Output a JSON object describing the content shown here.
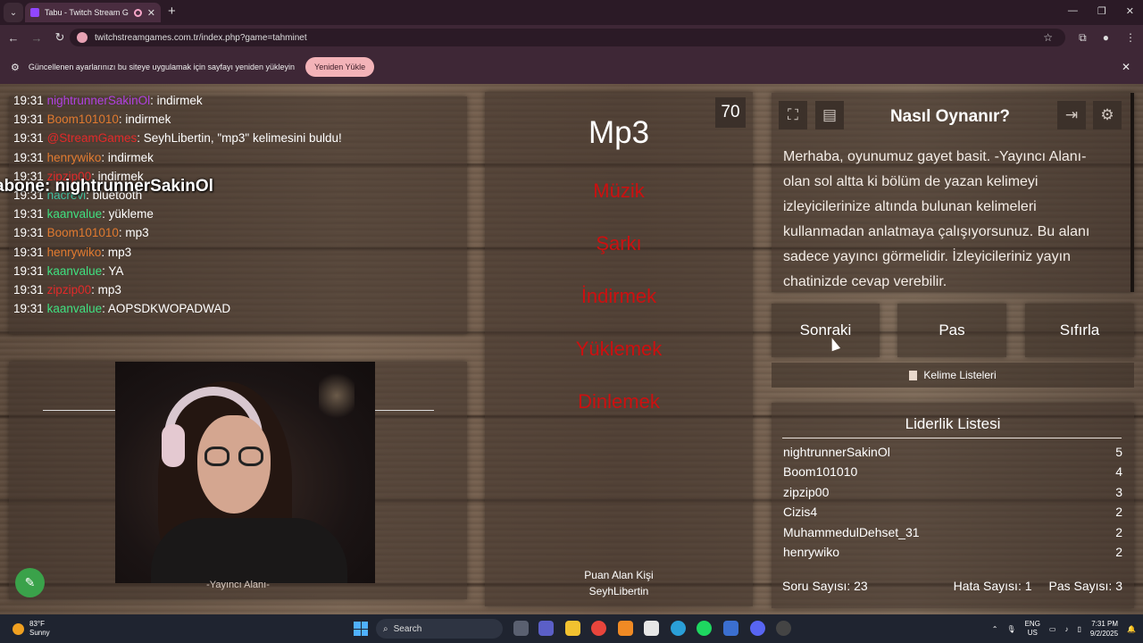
{
  "browser": {
    "tab_title": "Tabu - Twitch Stream Games",
    "url": "twitchstreamgames.com.tr/index.php?game=tahminet",
    "infobar_text": "Güncellenen ayarlarınızı bu siteye uygulamak için sayfayı yeniden yükleyin",
    "reload_label": "Yeniden Yükle"
  },
  "chat": {
    "lines": [
      {
        "time": "19:31",
        "user": "nightrunnerSakinOl",
        "color": "#b040e0",
        "msg": ": indirmek"
      },
      {
        "time": "19:31",
        "user": "Boom101010",
        "color": "#e07a30",
        "msg": ": indirmek"
      },
      {
        "time": "19:31",
        "user": "@StreamGames",
        "color": "#e02a2a",
        "msg": ": SeyhLibertin, \"mp3\" kelimesini buldu!"
      },
      {
        "time": "19:31",
        "user": "henrywiko",
        "color": "#e07a30",
        "msg": ": indirmek"
      },
      {
        "time": "19:31",
        "user": "zipzip00",
        "color": "#e02a2a",
        "msg": ": indirmek"
      },
      {
        "time": "19:31",
        "user": "nacrevi",
        "color": "#40c0a0",
        "msg": ": bluetooth"
      },
      {
        "time": "19:31",
        "user": "kaanvalue",
        "color": "#40e080",
        "msg": ": yükleme"
      },
      {
        "time": "19:31",
        "user": "Boom101010",
        "color": "#e07a30",
        "msg": ": mp3"
      },
      {
        "time": "19:31",
        "user": "henrywiko",
        "color": "#e07a30",
        "msg": ": mp3"
      },
      {
        "time": "19:31",
        "user": "kaanvalue",
        "color": "#40e080",
        "msg": ": YA"
      },
      {
        "time": "19:31",
        "user": "zipzip00",
        "color": "#e02a2a",
        "msg": ": mp3"
      },
      {
        "time": "19:31",
        "user": "kaanvalue",
        "color": "#40e080",
        "msg": ": AOPSDKWOPADWAD"
      }
    ],
    "overlay": "abone: nightrunnerSakinOl"
  },
  "streamer": {
    "caption": "-Yayıncı Alanı-"
  },
  "game": {
    "timer": "70",
    "word": "Mp3",
    "forbidden": [
      "Müzik",
      "Şarkı",
      "İndirmek",
      "Yüklemek",
      "Dinlemek"
    ],
    "point_label": "Puan Alan Kişi",
    "point_user": "SeyhLibertin"
  },
  "howto": {
    "title": "Nasıl Oynanır?",
    "text": "Merhaba, oyunumuz gayet basit. -Yayıncı Alanı- olan sol altta ki bölüm de yazan kelimeyi izleyicilerinize altında bulunan kelimeleri kullanmadan anlatmaya çalışıyorsunuz. Bu alanı sadece yayıncı görmelidir. İzleyicileriniz yayın chatinizde cevap verebilir."
  },
  "actions": {
    "next": "Sonraki",
    "pass": "Pas",
    "reset": "Sıfırla",
    "word_lists": "Kelime Listeleri"
  },
  "leaderboard": {
    "title": "Liderlik Listesi",
    "rows": [
      {
        "name": "nightrunnerSakinOl",
        "score": "5"
      },
      {
        "name": "Boom101010",
        "score": "4"
      },
      {
        "name": "zipzip00",
        "score": "3"
      },
      {
        "name": "Cizis4",
        "score": "2"
      },
      {
        "name": "MuhammedulDehset_31",
        "score": "2"
      },
      {
        "name": "henrywiko",
        "score": "2"
      }
    ],
    "questions": "Soru Sayısı: 23",
    "errors": "Hata Sayısı: 1",
    "passes": "Pas Sayısı: 3"
  },
  "taskbar": {
    "temp": "83°F",
    "weather": "Sunny",
    "search": "Search",
    "lang1": "ENG",
    "lang2": "US",
    "time": "7:31 PM",
    "date": "9/2/2025"
  }
}
